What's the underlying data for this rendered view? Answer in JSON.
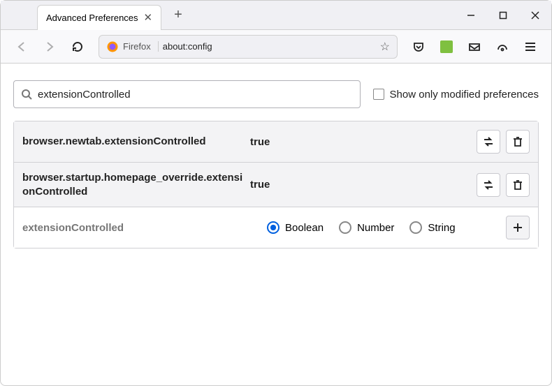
{
  "tab": {
    "title": "Advanced Preferences"
  },
  "address": {
    "brand": "Firefox",
    "url": "about:config"
  },
  "search": {
    "value": "extensionControlled",
    "filter_label": "Show only modified preferences"
  },
  "prefs": [
    {
      "name": "browser.newtab.extensionControlled",
      "value": "true"
    },
    {
      "name": "browser.startup.homepage_override.extensionControlled",
      "value": "true"
    }
  ],
  "new_pref": {
    "name": "extensionControlled",
    "types": [
      "Boolean",
      "Number",
      "String"
    ],
    "selected": "Boolean"
  }
}
